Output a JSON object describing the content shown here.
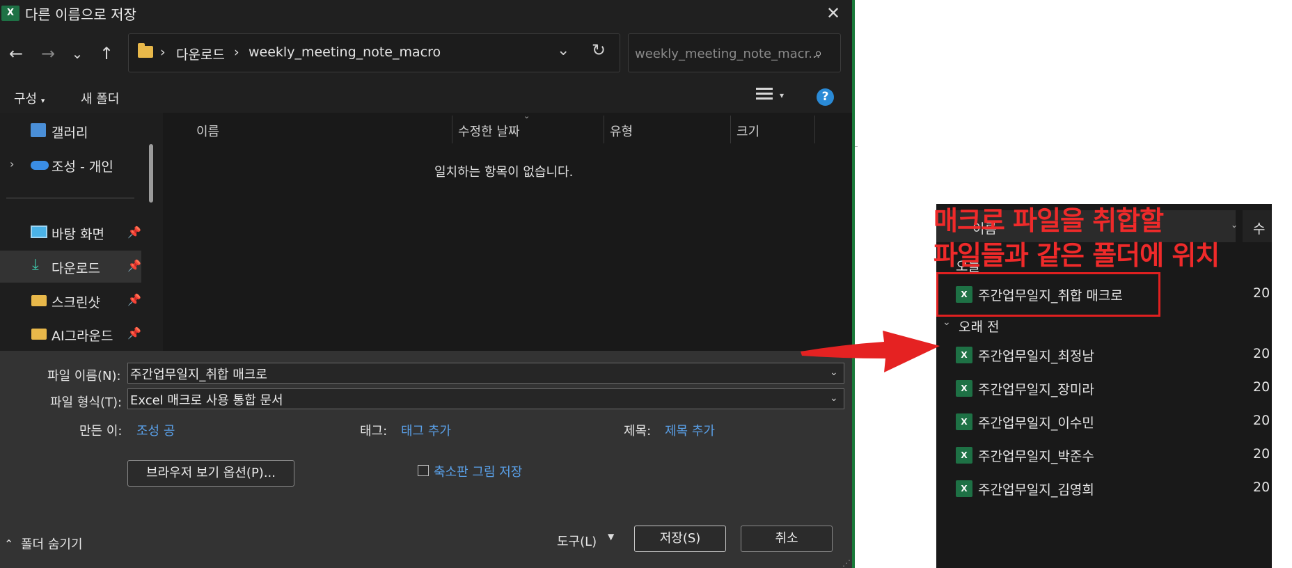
{
  "dialog": {
    "title": "다른 이름으로 저장",
    "close_glyph": "✕",
    "nav": {
      "back": "←",
      "forward": "→",
      "recent": "⌄",
      "up": "↑"
    },
    "breadcrumb": [
      "다운로드",
      "weekly_meeting_note_macro"
    ],
    "crumb_sep": "›",
    "search_placeholder": "weekly_meeting_note_macr...",
    "toolbar": {
      "organize": "구성",
      "new_folder": "새 폴더"
    },
    "sidebar": [
      {
        "label": "갤러리",
        "icon": "gallery-icon",
        "pinned": false
      },
      {
        "label": "조성 - 개인",
        "icon": "onedrive-icon",
        "pinned": false
      },
      {
        "label": "바탕 화면",
        "icon": "desktop-icon",
        "pinned": true
      },
      {
        "label": "다운로드",
        "icon": "download-icon",
        "pinned": true
      },
      {
        "label": "스크린샷",
        "icon": "folder-icon",
        "pinned": true
      },
      {
        "label": "AI그라운드",
        "icon": "folder-icon",
        "pinned": true
      }
    ],
    "columns": {
      "name": "이름",
      "modified": "수정한 날짜",
      "type": "유형",
      "size": "크기"
    },
    "empty_message": "일치하는 항목이 없습니다.",
    "file_name_label": "파일 이름(N):",
    "file_name_value": "주간업무일지_취합 매크로",
    "file_type_label": "파일 형식(T):",
    "file_type_value": "Excel 매크로 사용 통합 문서",
    "author_label": "만든 이:",
    "author_value": "조성 공",
    "tags_label": "태그:",
    "tags_value": "태그 추가",
    "title_label": "제목:",
    "title_value": "제목 추가",
    "browser_options": "브라우저 보기 옵션(P)...",
    "thumbnail_label": "축소판 그림 저장",
    "hide_folders": "폴더 숨기기",
    "tools": "도구(L)",
    "save": "저장(S)",
    "cancel": "취소"
  },
  "explorer_panel": {
    "header_name": "이름",
    "header_date": "수",
    "group_today": "오늘",
    "group_old": "오래 전",
    "today_files": [
      {
        "name": "주간업무일지_취합 매크로",
        "date": "20"
      }
    ],
    "old_files": [
      {
        "name": "주간업무일지_최정남",
        "date": "20"
      },
      {
        "name": "주간업무일지_장미라",
        "date": "20"
      },
      {
        "name": "주간업무일지_이수민",
        "date": "20"
      },
      {
        "name": "주간업무일지_박준수",
        "date": "20"
      },
      {
        "name": "주간업무일지_김영희",
        "date": "20"
      }
    ]
  },
  "annotation": {
    "line1": "매크로 파일을 취합할",
    "line2": "파일들과 같은 폴더에 위치",
    "color": "#ef2a2a"
  },
  "colors": {
    "dialog_bg": "#202020",
    "bottom_bg": "#333333",
    "link": "#5aa0e8",
    "excel_green": "#1e7145"
  }
}
